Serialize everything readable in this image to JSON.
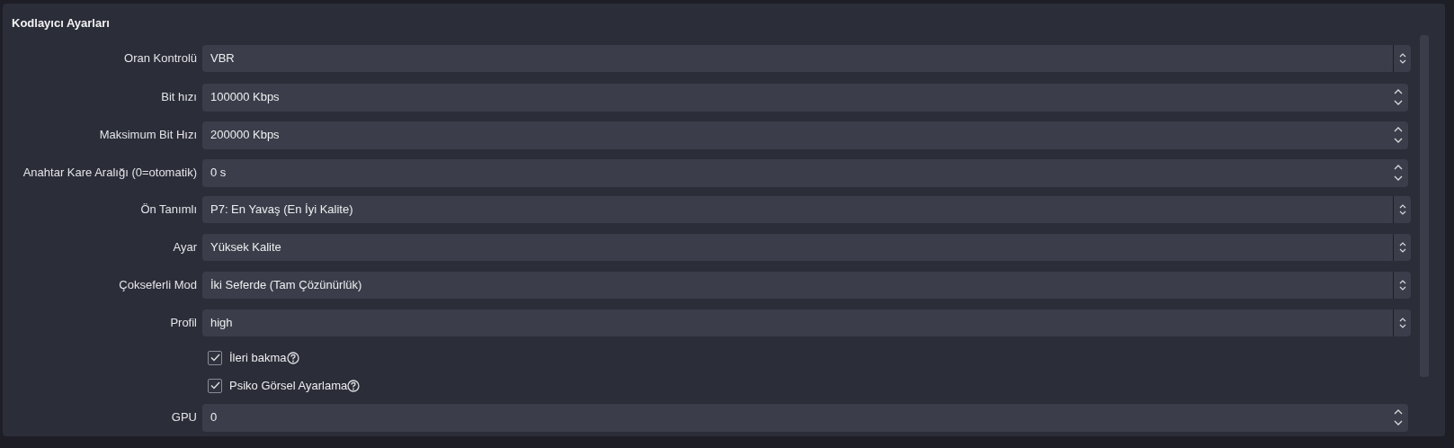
{
  "panel": {
    "title": "Kodlayıcı Ayarları"
  },
  "rows": [
    {
      "kind": "combo",
      "label": "Oran Kontrolü",
      "value": "VBR"
    },
    {
      "kind": "spin",
      "label": "Bit hızı",
      "value": "100000 Kbps"
    },
    {
      "kind": "spin",
      "label": "Maksimum Bit Hızı",
      "value": "200000 Kbps"
    },
    {
      "kind": "spin",
      "label": "Anahtar Kare Aralığı (0=otomatik)",
      "value": "0 s"
    },
    {
      "kind": "combo",
      "label": "Ön Tanımlı",
      "value": "P7: En Yavaş (En İyi Kalite)"
    },
    {
      "kind": "combo",
      "label": "Ayar",
      "value": "Yüksek Kalite"
    },
    {
      "kind": "combo",
      "label": "Çokseferli Mod",
      "value": "İki Seferde (Tam Çözünürlük)"
    },
    {
      "kind": "combo",
      "label": "Profil",
      "value": "high"
    },
    {
      "kind": "checkbox",
      "label": "İleri bakma",
      "checked": true
    },
    {
      "kind": "checkbox",
      "label": "Psiko Görsel Ayarlama",
      "checked": true
    },
    {
      "kind": "spin",
      "label": "GPU",
      "value": "0"
    }
  ]
}
